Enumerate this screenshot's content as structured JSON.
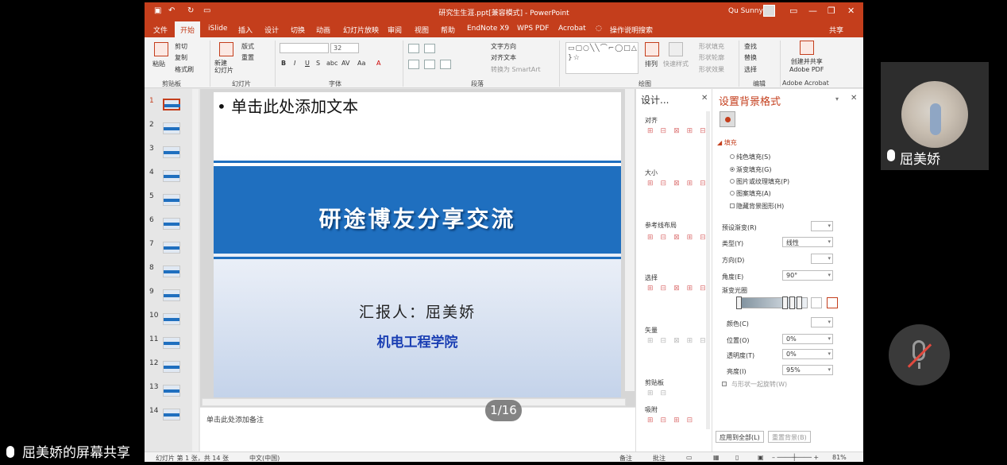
{
  "window": {
    "doc_title": "研究生生涯.ppt[兼容模式] - PowerPoint",
    "user": "Qu Sunny",
    "share_label": "共享"
  },
  "tabs": [
    "文件",
    "开始",
    "iSlide",
    "插入",
    "设计",
    "切换",
    "动画",
    "幻灯片放映",
    "审阅",
    "视图",
    "帮助",
    "EndNote X9",
    "WPS PDF",
    "Acrobat",
    "操作说明搜索"
  ],
  "active_tab": "开始",
  "ribbon": {
    "clipboard": {
      "paste": "粘贴",
      "cut": "剪切",
      "copy": "复制",
      "format_painter": "格式刷",
      "label": "剪贴板"
    },
    "slides": {
      "new_slide": "新建\n幻灯片",
      "layout": "版式",
      "reset": "重置",
      "label": "幻灯片"
    },
    "font": {
      "size": "32",
      "bold": "B",
      "italic": "I",
      "underline": "U",
      "strike": "S",
      "shadow": "abc",
      "spacing": "AV",
      "case": "Aa",
      "color": "A",
      "label": "字体"
    },
    "paragraph": {
      "text_direction": "文字方向",
      "align_text": "对齐文本",
      "smartart": "转换为 SmartArt",
      "label": "段落"
    },
    "drawing": {
      "arrange": "排列",
      "quick_styles": "快速样式",
      "shape_fill": "形状填充",
      "shape_outline": "形状轮廓",
      "shape_effects": "形状效果",
      "label": "绘图"
    },
    "editing": {
      "find": "查找",
      "replace": "替换",
      "select": "选择",
      "label": "编辑"
    },
    "acrobat": {
      "create": "创建并共享\nAdobe PDF",
      "label": "Adobe Acrobat"
    }
  },
  "thumbnails": [
    "1",
    "2",
    "3",
    "4",
    "5",
    "6",
    "7",
    "8",
    "9",
    "10",
    "11",
    "12",
    "13",
    "14"
  ],
  "active_slide": 1,
  "slide": {
    "bullet": "• 单击此处添加文本",
    "title": "研途博友分享交流",
    "reporter": "汇报人：屈美娇",
    "college": "机电工程学院"
  },
  "notes_placeholder": "单击此处添加备注",
  "design_panel": {
    "title": "设计...",
    "sections": [
      "对齐",
      "大小",
      "参考线布局",
      "选择",
      "矢量",
      "剪贴板",
      "吸附"
    ]
  },
  "format_panel": {
    "title": "设置背景格式",
    "fill_section": "填充",
    "fill_options": [
      {
        "label": "纯色填充(S)",
        "selected": false
      },
      {
        "label": "渐变填充(G)",
        "selected": true
      },
      {
        "label": "图片或纹理填充(P)",
        "selected": false
      },
      {
        "label": "图案填充(A)",
        "selected": false
      }
    ],
    "hide_bg": "隐藏背景图形(H)",
    "preset_label": "预设渐变(R)",
    "type_label": "类型(Y)",
    "type_value": "线性",
    "direction_label": "方向(D)",
    "angle_label": "角度(E)",
    "angle_value": "90°",
    "stops_label": "渐变光圈",
    "color_label": "颜色(C)",
    "position_label": "位置(O)",
    "position_value": "0%",
    "transparency_label": "透明度(T)",
    "transparency_value": "0%",
    "brightness_label": "亮度(I)",
    "brightness_value": "95%",
    "rotate_with_shape": "与形状一起旋转(W)",
    "apply_all": "应用到全部(L)",
    "reset_bg": "重置背景(B)"
  },
  "statusbar": {
    "slide_info": "幻灯片 第 1 张，共 14 张",
    "language": "中文(中国)",
    "notes": "备注",
    "comments": "批注",
    "zoom": "81%"
  },
  "meeting": {
    "participant_name": "屈美娇",
    "share_caption": "屈美娇的屏幕共享",
    "page_indicator": "1/16"
  },
  "colors": {
    "ppt_accent": "#c43e1c",
    "slide_banner": "#1f6fbf",
    "college_text": "#1b3fb3"
  }
}
